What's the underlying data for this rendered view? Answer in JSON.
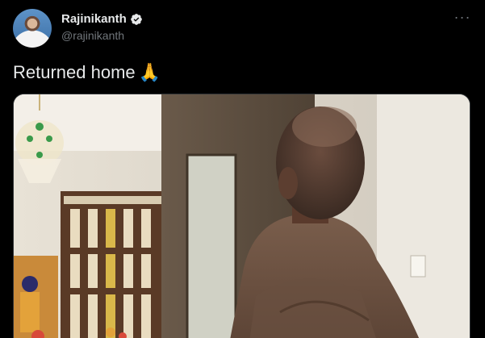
{
  "tweet": {
    "author": {
      "display_name": "Rajinikanth",
      "handle": "@rajinikanth",
      "verified": true,
      "avatar_icon": "profile-avatar"
    },
    "more_label": "···",
    "text": "Returned home",
    "emoji": "🙏",
    "media_alt": ""
  },
  "colors": {
    "background": "#000000",
    "primary_text": "#e7e9ea",
    "secondary_text": "#71767b",
    "border": "#2f3336"
  }
}
